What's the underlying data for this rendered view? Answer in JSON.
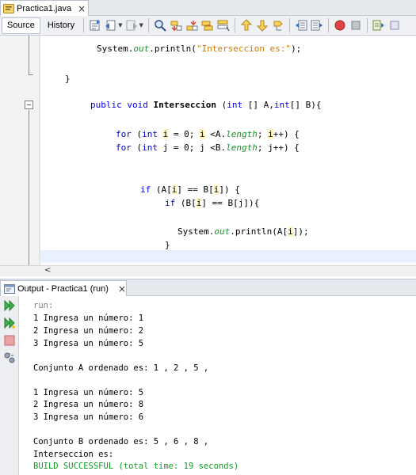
{
  "editor_tab": {
    "label": "Practica1.java",
    "close": "×"
  },
  "toolbar": {
    "source_label": "Source",
    "history_label": "History"
  },
  "code": {
    "println1": "System.out.println(\"Interseccion es:\");",
    "brace_close": "}",
    "method_sig": "public void Interseccion (int [] A,int[] B){",
    "for_i": "for (int i = 0; i <A.length; i++) {",
    "for_j": "for (int j = 0; j <B.length; j++) {",
    "if_outer": "if (A[i] == B[i]) {",
    "if_inner": "if (B[i] == B[j]){",
    "println2": "System.out.println(A[i]);",
    "brace_inner": "}"
  },
  "scroll": {
    "left_arrow": "<"
  },
  "output_tab": {
    "label": "Output - Practica1 (run)",
    "close": "×"
  },
  "output": {
    "lines": [
      "run:",
      "1 Ingresa un número: 1",
      "2 Ingresa un número: 2",
      "3 Ingresa un número: 5",
      "",
      "Conjunto A ordenado es: 1 , 2 , 5 ,",
      "",
      "1 Ingresa un número: 5",
      "2 Ingresa un número: 8",
      "3 Ingresa un número: 6",
      "",
      "Conjunto B ordenado es: 5 , 6 , 8 ,",
      "Interseccion es:",
      "BUILD SUCCESSFUL (total time: 19 seconds)"
    ]
  },
  "colors": {
    "keyword": "#0000e6",
    "field": "#1a8f2b",
    "string": "#ce7b00",
    "build_success": "#109a25",
    "run_label": "#808080"
  },
  "icons": {
    "toolbar": [
      "last-edit-icon",
      "back-icon",
      "forward-icon",
      "find-icon",
      "find-prev-icon",
      "find-next-icon",
      "find-selection-icon",
      "toggle-highlight-icon",
      "toggle-rect-icon",
      "prev-bookmark-icon",
      "next-bookmark-icon",
      "toggle-bookmark-icon",
      "shift-left-icon",
      "shift-right-icon",
      "record-macro-icon",
      "stop-macro-icon",
      "diff-icon"
    ],
    "output_side": [
      "rerun-icon",
      "rerun-with-options-icon",
      "stop-icon",
      "settings-icon"
    ]
  }
}
